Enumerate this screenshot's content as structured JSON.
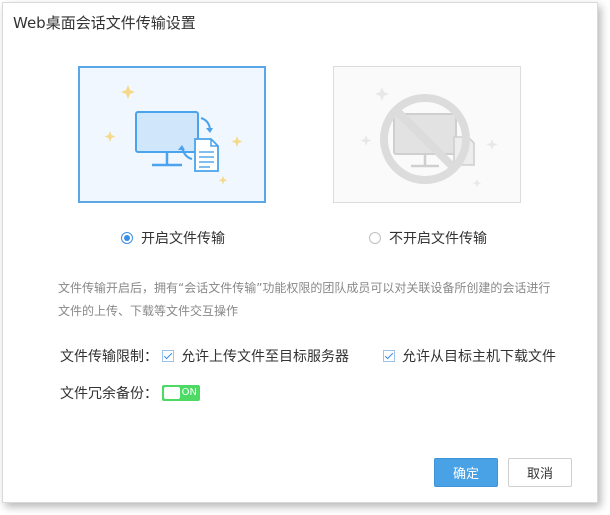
{
  "dialog": {
    "title": "Web桌面会话文件传输设置",
    "description": "文件传输开启后，拥有“会话文件传输”功能权限的团队成员可以对关联设备所创建的会话进行文件的上传、下载等文件交互操作",
    "options": {
      "enable": {
        "label": "开启文件传输",
        "selected": true
      },
      "disable": {
        "label": "不开启文件传输",
        "selected": false
      }
    },
    "limits": {
      "label": "文件传输限制：",
      "upload": {
        "label": "允许上传文件至目标服务器",
        "checked": true
      },
      "download": {
        "label": "允许从目标主机下载文件",
        "checked": true
      }
    },
    "backup": {
      "label": "文件冗余备份：",
      "toggle_text": "ON",
      "on": true
    },
    "buttons": {
      "confirm": "确定",
      "cancel": "取消"
    },
    "colors": {
      "accent": "#49a1e6",
      "toggle_on": "#4cd964"
    },
    "icons": {
      "enable_card": "monitor-file-transfer-icon",
      "disable_card": "monitor-forbidden-icon"
    }
  }
}
